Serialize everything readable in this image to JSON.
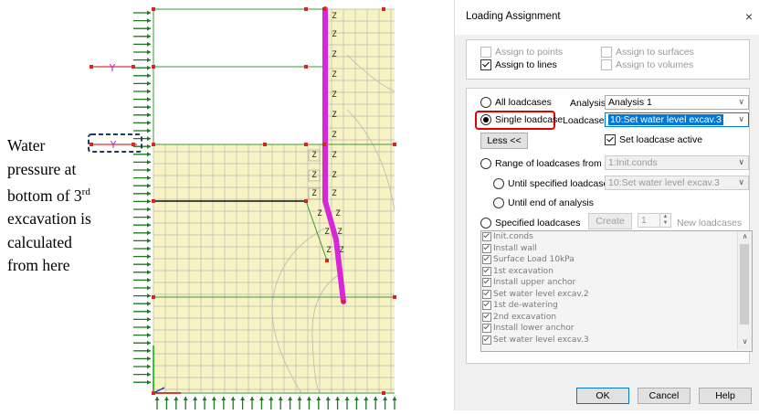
{
  "figure": {
    "annotation": {
      "line1": "Water",
      "line2": "pressure at",
      "line3a": "bottom of 3",
      "line3sup": "rd",
      "line4": "excavation is",
      "line5": "calculated",
      "line6": "from here"
    },
    "node_label": "Y",
    "wall_label": "Z",
    "colors": {
      "mesh_fill": "#f7f3c3",
      "mesh_line": "#b9b9b9",
      "wall": "#d926d9",
      "support_arrows": "#1b7a1b",
      "nodes": "#dd2222"
    }
  },
  "dialog": {
    "title": "Loading Assignment",
    "close": "×",
    "assign": {
      "points": "Assign to points",
      "lines": "Assign to lines",
      "surfaces": "Assign to surfaces",
      "volumes": "Assign to volumes"
    },
    "all_loadcases": "All loadcases",
    "analysis_label": "Analysis",
    "analysis_value": "Analysis 1",
    "single_loadcase": "Single loadcase",
    "loadcase_label": "Loadcase",
    "loadcase_value": "10:Set water level excav.3",
    "less_button": "Less <<",
    "set_active": "Set loadcase active",
    "range_from": "Range of loadcases from",
    "range_from_value": "1:Init.conds",
    "until_specified": "Until specified loadcase",
    "until_specified_value": "10:Set water level excav.3",
    "until_end": "Until end of analysis",
    "specified": "Specified loadcases",
    "create_button": "Create",
    "spin_value": "1",
    "new_loadcases": "New loadcases",
    "loadcases": [
      "Init.conds",
      "Install wall",
      "Surface Load 10kPa",
      "1st excavation",
      "Install upper anchor",
      "Set water level excav.2",
      "1st de-watering",
      "2nd excavation",
      "Install lower anchor",
      "Set water level excav.3"
    ],
    "ok": "OK",
    "cancel": "Cancel",
    "help": "Help"
  }
}
